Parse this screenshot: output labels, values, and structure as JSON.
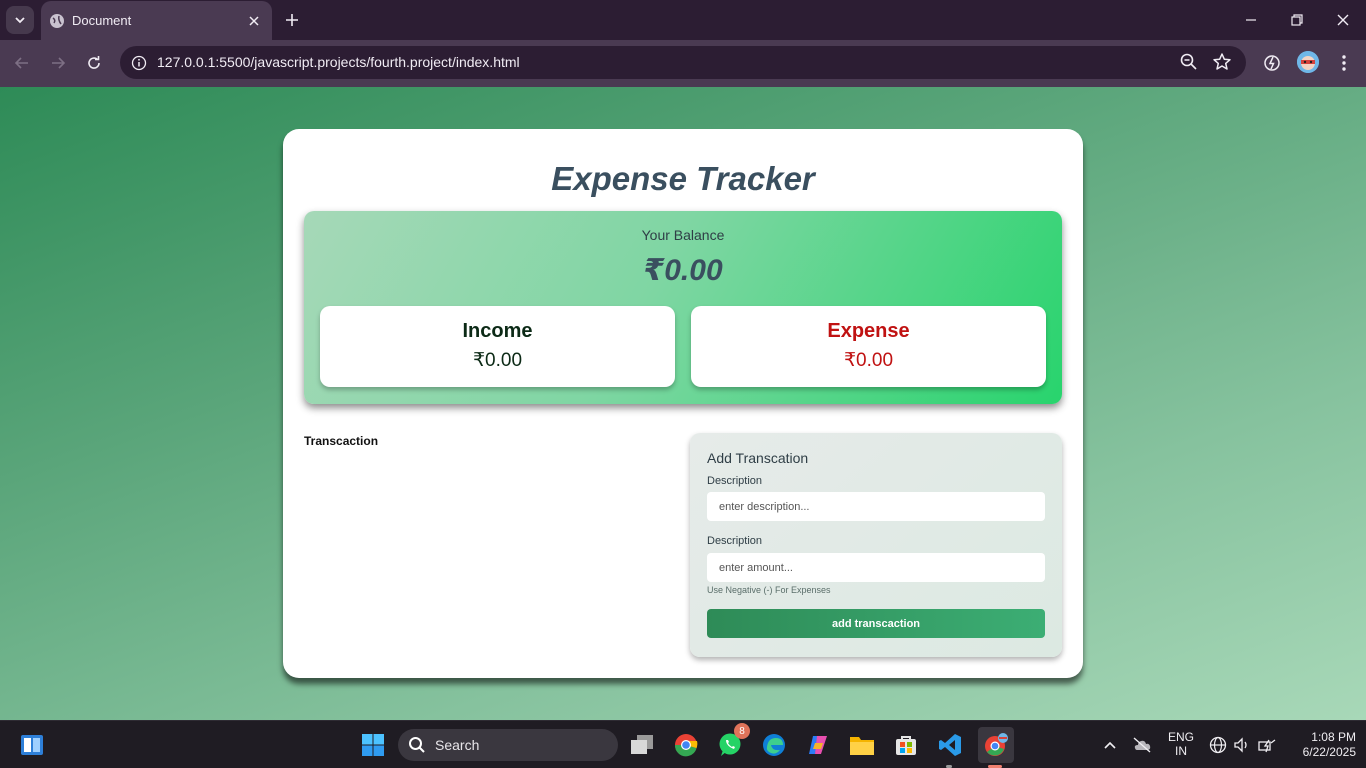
{
  "browser": {
    "tab_title": "Document",
    "url": "127.0.0.1:5500/javascript.projects/fourth.project/index.html"
  },
  "page": {
    "title": "Expense Tracker",
    "balance": {
      "label": "Your Balance",
      "value": "₹0.00"
    },
    "income": {
      "label": "Income",
      "value": "₹0.00"
    },
    "expense": {
      "label": "Expense",
      "value": "₹0.00"
    },
    "transactions_heading": "Transcaction",
    "form": {
      "heading": "Add Transcation",
      "description_label": "Description",
      "description_placeholder": "enter description...",
      "amount_label": "Description",
      "amount_placeholder": "enter amount...",
      "hint": "Use Negative (-) For Expenses",
      "submit_label": "add transcaction"
    }
  },
  "taskbar": {
    "search_label": "Search",
    "whatsapp_badge": "8",
    "language_top": "ENG",
    "language_bottom": "IN",
    "time": "1:08 PM",
    "date": "6/22/2025"
  },
  "colors": {
    "accent_green": "#2e8b57",
    "expense_red": "#c01212",
    "title_slate": "#3a4f5f"
  }
}
